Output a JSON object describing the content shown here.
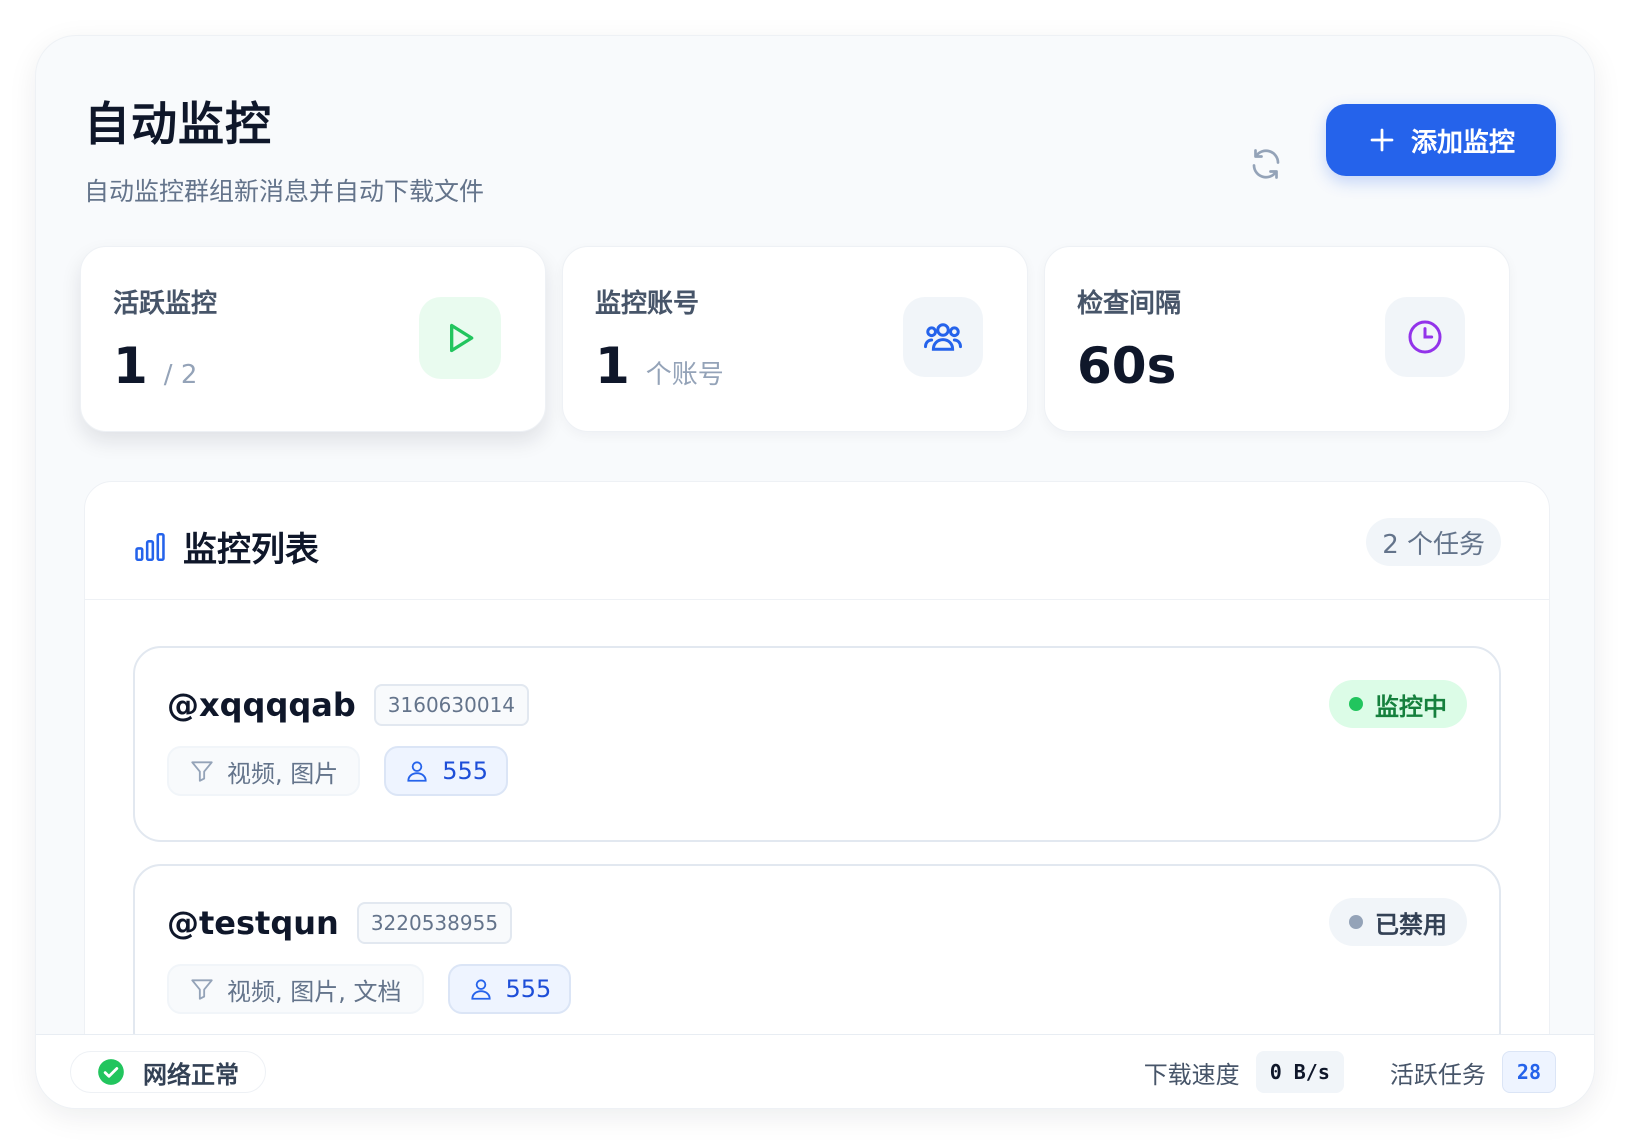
{
  "header": {
    "title": "自动监控",
    "subtitle": "自动监控群组新消息并自动下载文件",
    "refresh_icon": "refresh-icon",
    "add_button_label": "添加监控"
  },
  "stats": [
    {
      "label": "活跃监控",
      "value": "1",
      "sub": "/ 2",
      "icon": "play-icon",
      "accent": "#22c55e"
    },
    {
      "label": "监控账号",
      "value": "1",
      "sub": "个账号",
      "icon": "users-icon",
      "accent": "#2563eb"
    },
    {
      "label": "检查间隔",
      "value": "60s",
      "sub": "",
      "icon": "clock-icon",
      "accent": "#9333ea"
    }
  ],
  "list": {
    "title": "监控列表",
    "count_label": "2 个任务",
    "items": [
      {
        "name": "@xqqqqab",
        "id": "3160630014",
        "filter": "视频, 图片",
        "account": "555",
        "status": "监控中",
        "status_color": "#22c55e"
      },
      {
        "name": "@testqun",
        "id": "3220538955",
        "filter": "视频, 图片, 文档",
        "account": "555",
        "status": "已禁用",
        "status_color": "#94a3b8"
      }
    ]
  },
  "status_bar": {
    "network": "网络正常",
    "download_speed_label": "下载速度",
    "download_speed_value": "0 B/s",
    "active_tasks_label": "活跃任务",
    "active_tasks_value": "28"
  },
  "colors": {
    "primary": "#2563eb",
    "success": "#22c55e",
    "purple": "#9333ea",
    "muted": "#94a3b8"
  }
}
